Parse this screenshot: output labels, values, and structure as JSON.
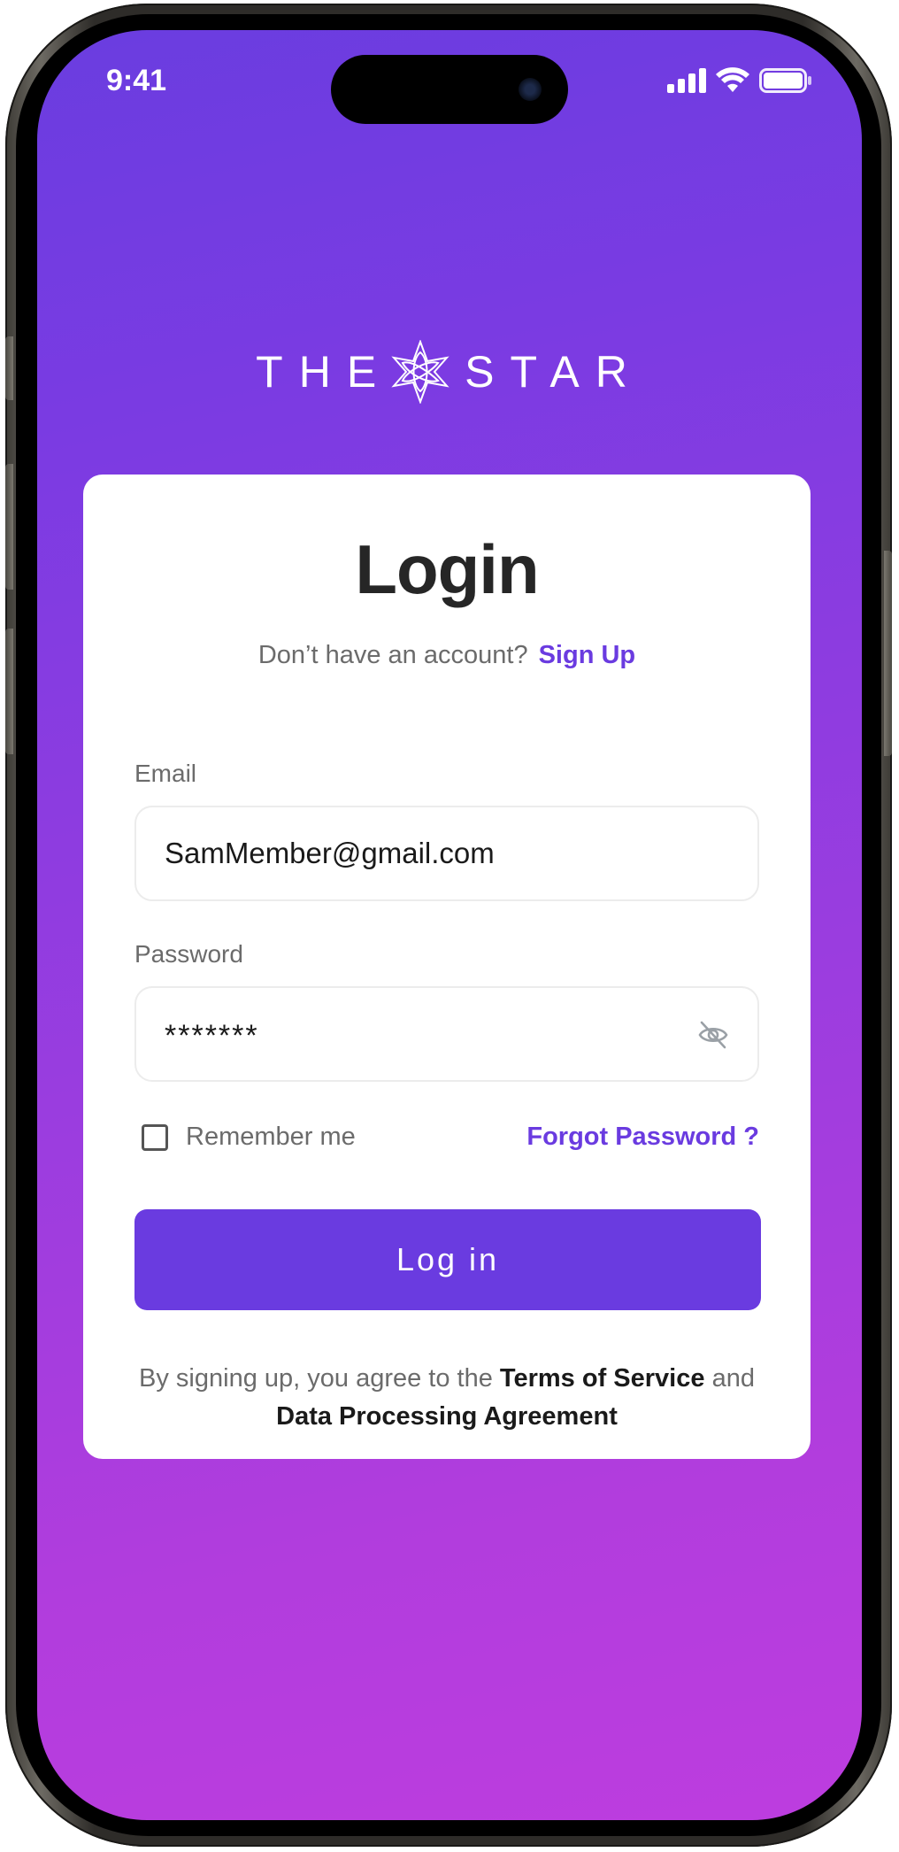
{
  "status_bar": {
    "time": "9:41"
  },
  "logo": {
    "left_word": "THE",
    "right_word": "STAR"
  },
  "login": {
    "title": "Login",
    "no_account_text": "Don’t have an account?",
    "sign_up_link": "Sign Up",
    "email_label": "Email",
    "email_value": "SamMember@gmail.com",
    "password_label": "Password",
    "password_value": "*******",
    "remember_me_label": "Remember me",
    "remember_me_checked": false,
    "forgot_password_link": "Forgot Password ?",
    "login_button": "Log in",
    "terms_prefix": "By signing up, you agree to the",
    "terms_of_service": "Terms of Service",
    "terms_and": "and",
    "data_processing_agreement": "Data Processing Agreement"
  },
  "colors": {
    "accent": "#6a3be0",
    "gradient_top": "#6a3de0",
    "gradient_bottom": "#bd3ddf",
    "card": "#ffffff"
  },
  "icons": {
    "logo": "star-flower-icon",
    "password_toggle": "eye-off-icon",
    "signal": "cellular-signal-icon",
    "wifi": "wifi-icon",
    "battery": "battery-icon"
  }
}
